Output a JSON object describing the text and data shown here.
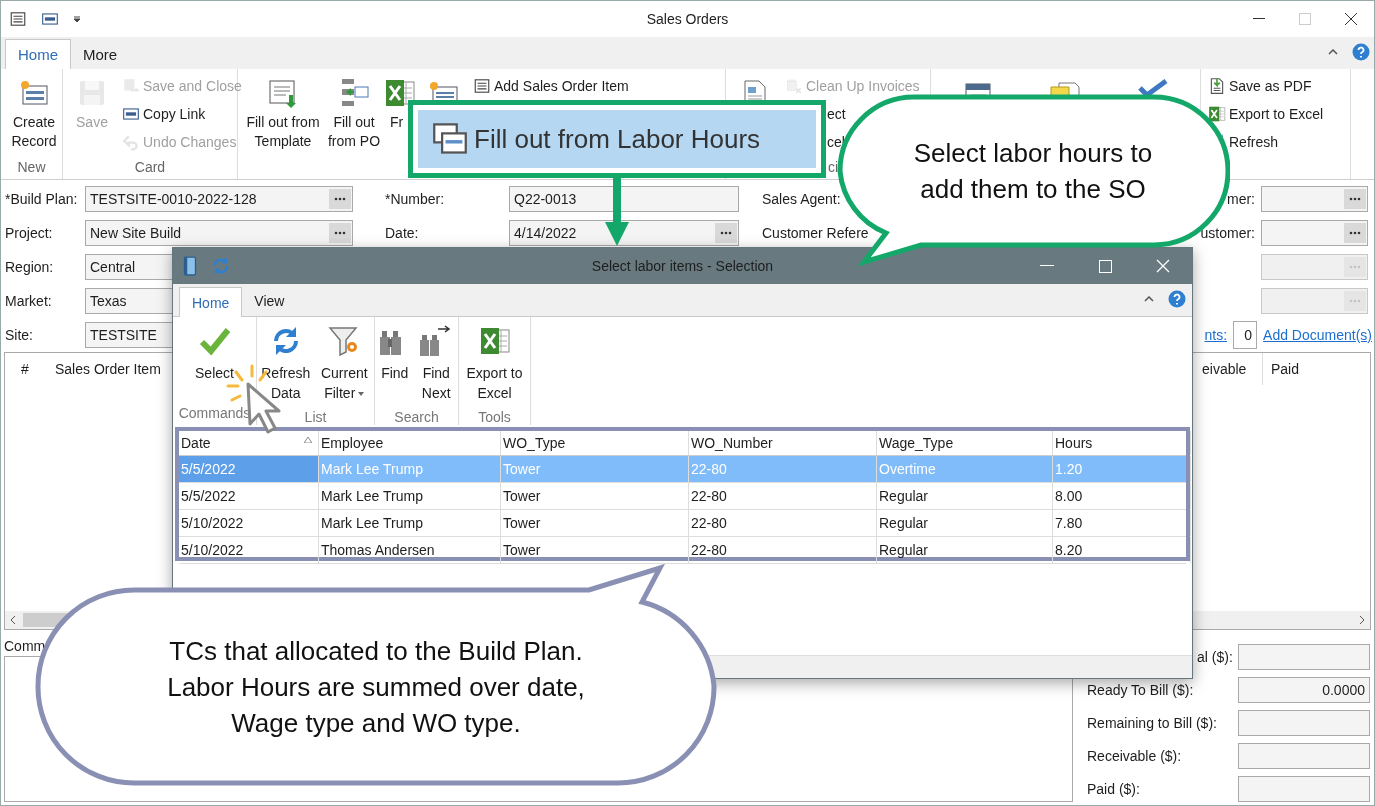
{
  "window": {
    "title": "Sales Orders"
  },
  "ribbon_tabs": [
    {
      "label": "Home",
      "selected": true
    },
    {
      "label": "More",
      "selected": false
    }
  ],
  "ribbon_groups": [
    {
      "label": "New",
      "items": [
        {
          "kind": "large",
          "label": "Create Record",
          "disabled": false
        }
      ]
    },
    {
      "label": "Card",
      "items": [
        {
          "kind": "large",
          "label": "Save",
          "disabled": true
        },
        {
          "kind": "small",
          "label": "Save and Close",
          "disabled": true
        },
        {
          "kind": "small",
          "label": "Copy Link",
          "disabled": false
        },
        {
          "kind": "small",
          "label": "Undo Changes",
          "disabled": true
        }
      ]
    },
    {
      "items": [
        {
          "kind": "large",
          "label": "Fill out from Template",
          "disabled": false
        },
        {
          "kind": "large",
          "label": "Fill out from PO",
          "disabled": false
        },
        {
          "kind": "large",
          "label": "Fr",
          "disabled": false
        },
        {
          "kind": "icon",
          "disabled": false
        },
        {
          "kind": "small",
          "label": "Add Sales Order Item",
          "disabled": false
        }
      ]
    },
    {
      "label": "ci",
      "items": [
        {
          "kind": "icon",
          "disabled": false
        },
        {
          "kind": "small",
          "label": "Clean Up Invoices",
          "disabled": true
        },
        {
          "kind": "small",
          "label": "ect",
          "disabled": false
        },
        {
          "kind": "small",
          "label": "cel",
          "disabled": false
        }
      ]
    },
    {
      "items": [
        {
          "kind": "icon",
          "disabled": false
        },
        {
          "kind": "icon",
          "disabled": false
        },
        {
          "kind": "icon",
          "disabled": false
        }
      ]
    },
    {
      "items": [
        {
          "kind": "small",
          "label": "Save as PDF",
          "disabled": false
        },
        {
          "kind": "small",
          "label": "Export to Excel",
          "disabled": false
        },
        {
          "kind": "small",
          "label": "Refresh",
          "disabled": false
        }
      ]
    }
  ],
  "form": {
    "left": [
      {
        "label": "*Build Plan:",
        "value": "TESTSITE-0010-2022-128",
        "kind": "lookup"
      },
      {
        "label": "Project:",
        "value": "New Site Build",
        "kind": "lookup"
      },
      {
        "label": "Region:",
        "value": "Central",
        "kind": "text"
      },
      {
        "label": "Market:",
        "value": "Texas",
        "kind": "text"
      },
      {
        "label": "Site:",
        "value": "TESTSITE",
        "kind": "text"
      }
    ],
    "middle": [
      {
        "label": "*Number:",
        "value": "Q22-0013",
        "kind": "text"
      },
      {
        "label": "Date:",
        "value": "4/14/2022",
        "kind": "lookup"
      }
    ],
    "right_labels": [
      "Sales Agent:",
      "Customer Refere"
    ],
    "far_right": [
      {
        "label": "mer:",
        "kind": "lookup",
        "disabled": false
      },
      {
        "label": "ustomer:",
        "kind": "lookup",
        "disabled": false
      },
      {
        "kind": "lookup",
        "disabled": true
      },
      {
        "kind": "lookup",
        "disabled": true
      }
    ],
    "documents": {
      "label": "nts:",
      "count": "0",
      "link": "Add Document(s)"
    }
  },
  "grid": {
    "columns": [
      "#",
      "Sales Order Item",
      "eivable",
      "Paid"
    ]
  },
  "comments": {
    "label": "Comm"
  },
  "totals": [
    {
      "label": "al ($):"
    },
    {
      "label": "Ready To Bill ($):",
      "value": "0.0000"
    },
    {
      "label": "Remaining to Bill ($):"
    },
    {
      "label": "Receivable ($):"
    },
    {
      "label": "Paid ($):"
    }
  ],
  "dialog": {
    "title": "Select labor items - Selection",
    "tabs": [
      {
        "label": "Home",
        "selected": true
      },
      {
        "label": "View",
        "selected": false
      }
    ],
    "groups": [
      {
        "label": "Commands",
        "items": [
          {
            "label": "Select",
            "dropdown": false
          }
        ]
      },
      {
        "label": "List",
        "items": [
          {
            "label": "Refresh Data",
            "dropdown": false
          },
          {
            "label": "Current Filter",
            "dropdown": true
          }
        ]
      },
      {
        "label": "Search",
        "items": [
          {
            "label": "Find",
            "dropdown": false
          },
          {
            "label": "Find Next",
            "dropdown": false
          }
        ]
      },
      {
        "label": "Tools",
        "items": [
          {
            "label": "Export to Excel",
            "dropdown": false
          }
        ]
      }
    ],
    "table": {
      "columns": [
        "Date",
        "Employee",
        "WO_Type",
        "WO_Number",
        "Wage_Type",
        "Hours"
      ],
      "rows": [
        {
          "selected": true,
          "cells": [
            "5/5/2022",
            "Mark Lee Trump",
            "Tower",
            "22-80",
            "Overtime",
            "1.20"
          ]
        },
        {
          "selected": false,
          "cells": [
            "5/5/2022",
            "Mark Lee Trump",
            "Tower",
            "22-80",
            "Regular",
            "8.00"
          ]
        },
        {
          "selected": false,
          "cells": [
            "5/10/2022",
            "Mark Lee Trump",
            "Tower",
            "22-80",
            "Regular",
            "7.80"
          ]
        },
        {
          "selected": false,
          "cells": [
            "5/10/2022",
            "Thomas Andersen",
            "Tower",
            "22-80",
            "Regular",
            "8.20"
          ]
        }
      ]
    }
  },
  "highlight": {
    "label": "Fill out from Labor Hours"
  },
  "callouts": [
    {
      "text": "Select labor hours to\nadd them to the SO",
      "color": "#13a86a"
    },
    {
      "text": "TCs that allocated to the Build Plan.\nLabor Hours are summed over date,\nWage type and WO type.",
      "color": "#8a90b4"
    }
  ]
}
